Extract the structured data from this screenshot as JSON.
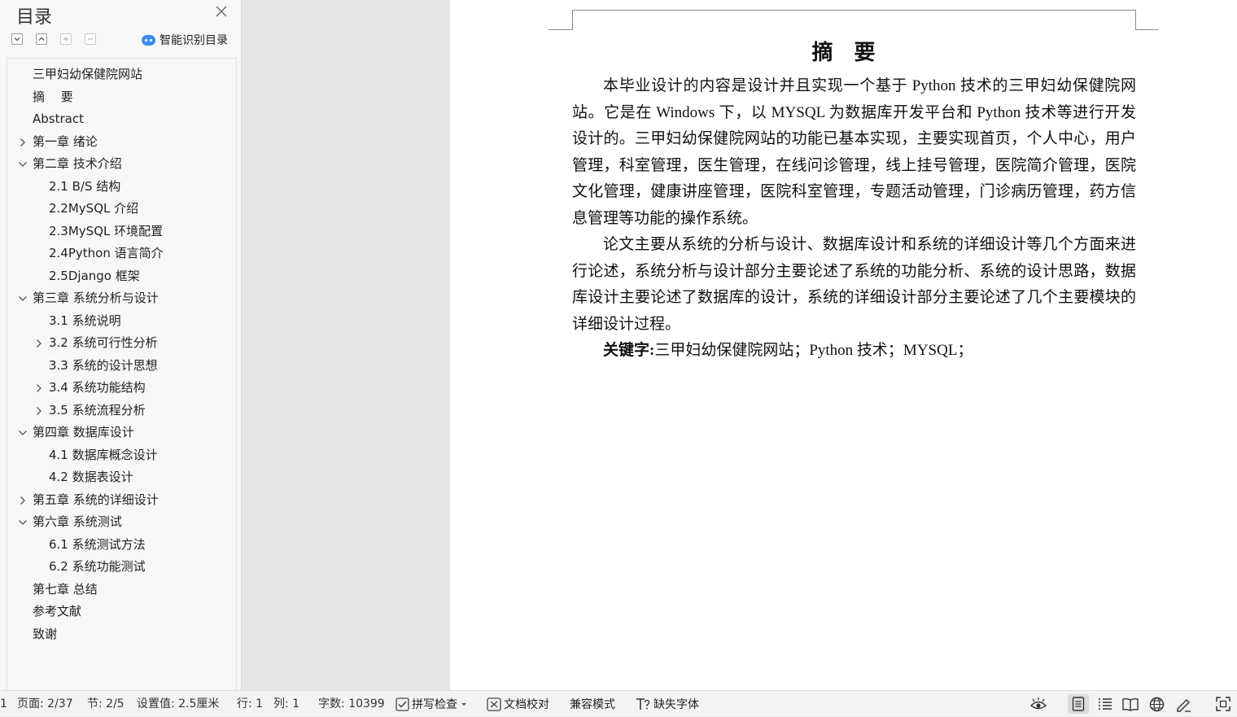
{
  "toc": {
    "title": "目录",
    "smart_toc_label": "智能识别目录",
    "items": [
      {
        "label": "三甲妇幼保健院网站",
        "level": 1,
        "expander": "none"
      },
      {
        "label": "摘　 要",
        "level": 1,
        "expander": "none"
      },
      {
        "label": "Abstract",
        "level": 1,
        "expander": "none"
      },
      {
        "label": "第一章  绪论",
        "level": 1,
        "expander": "collapsed"
      },
      {
        "label": "第二章  技术介绍",
        "level": 1,
        "expander": "expanded"
      },
      {
        "label": "2.1 B/S 结构",
        "level": 2,
        "expander": "none"
      },
      {
        "label": "2.2MySQL 介绍",
        "level": 2,
        "expander": "none"
      },
      {
        "label": "2.3MySQL 环境配置",
        "level": 2,
        "expander": "none"
      },
      {
        "label": "2.4Python 语言简介",
        "level": 2,
        "expander": "none"
      },
      {
        "label": "2.5Django 框架",
        "level": 2,
        "expander": "none"
      },
      {
        "label": "第三章  系统分析与设计",
        "level": 1,
        "expander": "expanded"
      },
      {
        "label": "3.1 系统说明",
        "level": 2,
        "expander": "none"
      },
      {
        "label": "3.2 系统可行性分析",
        "level": 2,
        "expander": "collapsed"
      },
      {
        "label": "3.3 系统的设计思想",
        "level": 2,
        "expander": "none"
      },
      {
        "label": "3.4 系统功能结构",
        "level": 2,
        "expander": "collapsed"
      },
      {
        "label": "3.5 系统流程分析",
        "level": 2,
        "expander": "collapsed"
      },
      {
        "label": "第四章  数据库设计",
        "level": 1,
        "expander": "expanded"
      },
      {
        "label": "4.1 数据库概念设计",
        "level": 2,
        "expander": "none"
      },
      {
        "label": "4.2 数据表设计",
        "level": 2,
        "expander": "none"
      },
      {
        "label": "第五章  系统的详细设计",
        "level": 1,
        "expander": "collapsed"
      },
      {
        "label": "第六章  系统测试",
        "level": 1,
        "expander": "expanded"
      },
      {
        "label": "6.1 系统测试方法",
        "level": 2,
        "expander": "none"
      },
      {
        "label": "6.2 系统功能测试",
        "level": 2,
        "expander": "none"
      },
      {
        "label": "第七章  总结",
        "level": 1,
        "expander": "none"
      },
      {
        "label": "参考文献",
        "level": 1,
        "expander": "none"
      },
      {
        "label": "致谢",
        "level": 1,
        "expander": "none"
      }
    ]
  },
  "document": {
    "title": "摘要",
    "paragraphs": [
      "本毕业设计的内容是设计并且实现一个基于 Python 技术的三甲妇幼保健院网站。它是在 Windows 下，以 MYSQL 为数据库开发平台和 Python 技术等进行开发设计的。三甲妇幼保健院网站的功能已基本实现，主要实现首页，个人中心，用户管理，科室管理，医生管理，在线问诊管理，线上挂号管理，医院简介管理，医院文化管理，健康讲座管理，医院科室管理，专题活动管理，门诊病历管理，药方信息管理等功能的操作系统。",
      "论文主要从系统的分析与设计、数据库设计和系统的详细设计等几个方面来进行论述，系统分析与设计部分主要论述了系统的功能分析、系统的设计思路，数据库设计主要论述了数据库的设计，系统的详细设计部分主要论述了几个主要模块的详细设计过程。"
    ],
    "keywords_label": "关键字:",
    "keywords_text": "三甲妇幼保健院网站；Python 技术；MYSQL；"
  },
  "statusbar": {
    "edge_char": "1",
    "page": "页面: 2/37",
    "section": "节: 2/5",
    "setting": "设置值: 2.5厘米",
    "row": "行: 1",
    "col": "列: 1",
    "word_count": "字数: 10399",
    "spell_check": "拼写检查",
    "doc_proof": "文档校对",
    "compat_mode": "兼容模式",
    "missing_fonts": "缺失字体"
  }
}
